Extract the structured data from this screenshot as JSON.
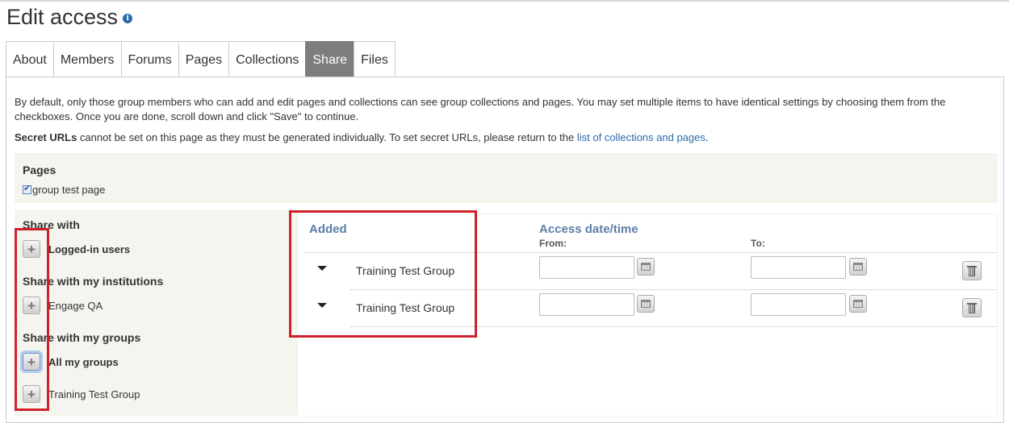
{
  "page": {
    "title": "Edit access",
    "info_icon": "i"
  },
  "tabs": [
    {
      "label": "About",
      "active": false
    },
    {
      "label": "Members",
      "active": false
    },
    {
      "label": "Forums",
      "active": false
    },
    {
      "label": "Pages",
      "active": false
    },
    {
      "label": "Collections",
      "active": false
    },
    {
      "label": "Share",
      "active": true
    },
    {
      "label": "Files",
      "active": false
    }
  ],
  "intro": {
    "text": "By default, only those group members who can add and edit pages and collections can see group collections and pages. You may set multiple items to have identical settings by choosing them from the checkboxes. Once you are done, scroll down and click \"Save\" to continue.",
    "secret_bold": "Secret URLs",
    "secret_text": " cannot be set on this page as they must be generated individually. To set secret URLs, please return to the ",
    "secret_link": "list of collections and pages",
    "secret_end": "."
  },
  "pages": {
    "title": "Pages",
    "items": [
      {
        "label": "group test page",
        "checked": true
      }
    ]
  },
  "share": {
    "share_with": "Share with",
    "logged_in": "Logged-in users",
    "institutions_heading": "Share with my institutions",
    "institution": "Engage QA",
    "groups_heading": "Share with my groups",
    "all_groups": "All my groups",
    "group": "Training Test Group"
  },
  "added": {
    "heading": "Added",
    "access_heading": "Access date/time",
    "from_label": "From:",
    "to_label": "To:",
    "rows": [
      {
        "name": "Training Test Group",
        "from": "",
        "to": ""
      },
      {
        "name": "Training Test Group",
        "from": "",
        "to": ""
      }
    ]
  },
  "colors": {
    "highlight_border": "#d0202a",
    "link": "#2b6bab",
    "tab_active_bg": "#7d7d7d",
    "panel_bg": "#f5f5ef"
  }
}
